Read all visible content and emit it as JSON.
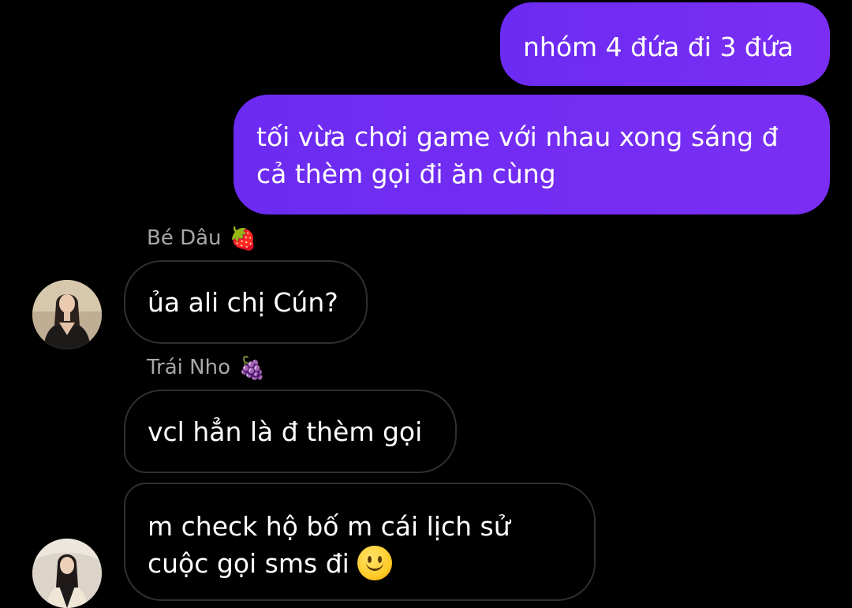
{
  "messages": {
    "outgoing": [
      {
        "text": "nhóm 4 đứa đi 3 đứa"
      },
      {
        "line1": "tối vừa chơi game với nhau xong sáng đ",
        "line2": "cả thèm gọi đi ăn cùng"
      }
    ],
    "incoming": [
      {
        "sender": "Bé Dâu",
        "sender_emoji": "🍓",
        "text": "ủa ali chị Cún?"
      },
      {
        "sender": "Trái Nho",
        "sender_emoji": "🍇",
        "text": "vcl hẳn là đ thèm gọi"
      },
      {
        "line1": "m check hộ bố m cái lịch sử",
        "line2": "cuộc gọi sms đi",
        "emoji": "slightly-smiling-face-icon"
      }
    ]
  },
  "colors": {
    "background": "#000000",
    "outgoing_bubble": "#7a2ef4",
    "incoming_border": "#2f2f2f",
    "sender_name": "#a8a8a8"
  }
}
